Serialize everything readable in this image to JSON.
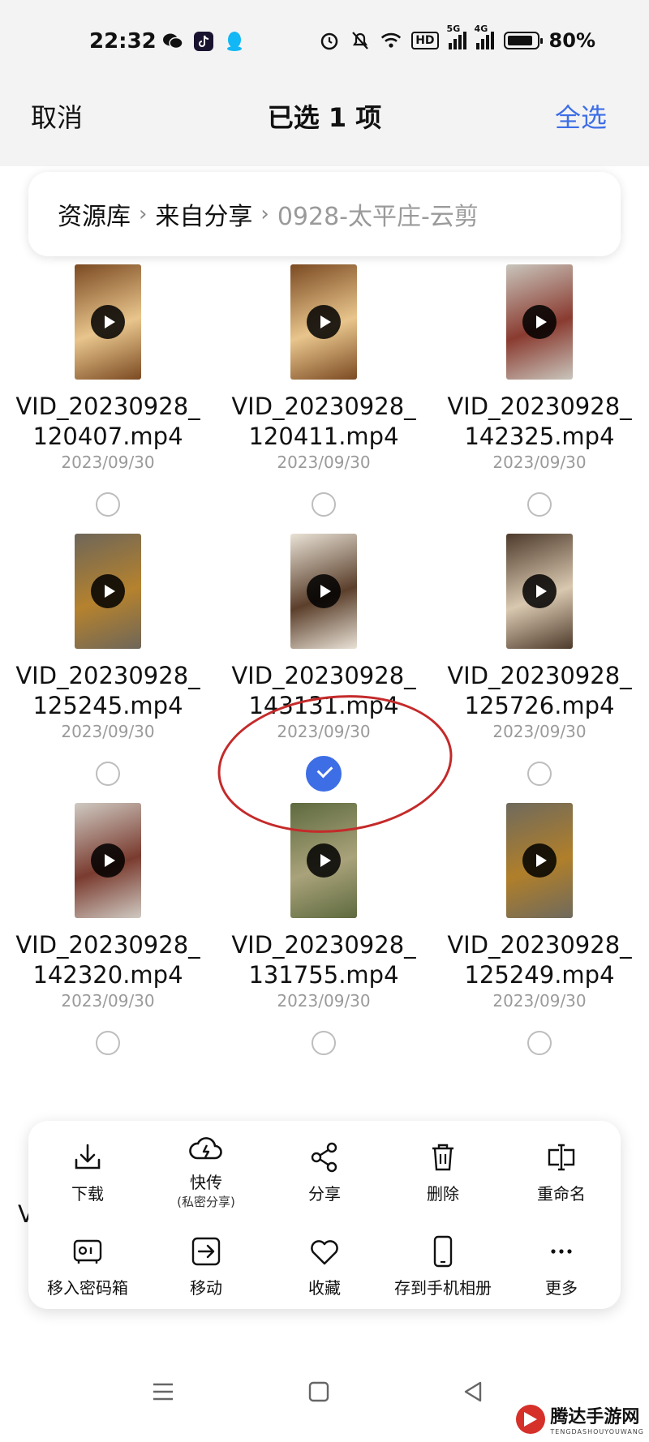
{
  "status_bar": {
    "time": "22:32",
    "left_icons": [
      "wechat-icon",
      "douyin-icon",
      "qq-icon"
    ],
    "right_icons": [
      "alarm-icon",
      "mute-icon",
      "wifi-icon",
      "hd-icon",
      "signal-5g-icon",
      "signal-4g-icon",
      "battery-icon"
    ],
    "hd_label": "HD",
    "sig1_label": "5G",
    "sig2_label": "4G",
    "battery": "80%"
  },
  "header": {
    "cancel": "取消",
    "title": "已选 1 项",
    "select_all": "全选"
  },
  "breadcrumb": [
    "资源库",
    "来自分享",
    "0928-太平庄-云剪"
  ],
  "files": [
    {
      "name1": "VID_20230928_",
      "name2": "120407.mp4",
      "date": "2023/09/30",
      "selected": false,
      "thumb_colors": [
        "#7b4a22",
        "#e8c58c"
      ]
    },
    {
      "name1": "VID_20230928_",
      "name2": "120411.mp4",
      "date": "2023/09/30",
      "selected": false,
      "thumb_colors": [
        "#7b4a22",
        "#e8c58c"
      ]
    },
    {
      "name1": "VID_20230928_",
      "name2": "142325.mp4",
      "date": "2023/09/30",
      "selected": false,
      "thumb_colors": [
        "#c9c5bc",
        "#8a3b30"
      ]
    },
    {
      "name1": "VID_20230928_",
      "name2": "125245.mp4",
      "date": "2023/09/30",
      "selected": false,
      "thumb_colors": [
        "#6e6659",
        "#b5822e"
      ]
    },
    {
      "name1": "VID_20230928_",
      "name2": "143131.mp4",
      "date": "2023/09/30",
      "selected": true,
      "thumb_colors": [
        "#e9e2d6",
        "#5b3f2b"
      ]
    },
    {
      "name1": "VID_20230928_",
      "name2": "125726.mp4",
      "date": "2023/09/30",
      "selected": false,
      "thumb_colors": [
        "#4d3a2b",
        "#d9c8b0"
      ]
    },
    {
      "name1": "VID_20230928_",
      "name2": "142320.mp4",
      "date": "2023/09/30",
      "selected": false,
      "thumb_colors": [
        "#cfcac2",
        "#7a3b2f"
      ]
    },
    {
      "name1": "VID_20230928_",
      "name2": "131755.mp4",
      "date": "2023/09/30",
      "selected": false,
      "thumb_colors": [
        "#5e6a3e",
        "#a9a27a"
      ]
    },
    {
      "name1": "VID_20230928_",
      "name2": "125249.mp4",
      "date": "2023/09/30",
      "selected": false,
      "thumb_colors": [
        "#6f6a5d",
        "#b07f2a"
      ]
    },
    {
      "name1": "V",
      "name2": "",
      "date": "",
      "selected": false,
      "partial": true
    },
    {
      "name1": "",
      "name2": "",
      "date": "",
      "selected": false,
      "partial": true
    },
    {
      "name1": "",
      "name2": "",
      "date": "",
      "selected": false,
      "partial": true
    }
  ],
  "actions": [
    {
      "label": "下载",
      "icon": "download-icon"
    },
    {
      "label": "快传",
      "sub": "(私密分享)",
      "icon": "cloud-flash-icon"
    },
    {
      "label": "分享",
      "icon": "share-icon"
    },
    {
      "label": "删除",
      "icon": "trash-icon"
    },
    {
      "label": "重命名",
      "icon": "rename-icon"
    },
    {
      "label": "移入密码箱",
      "icon": "safe-box-icon"
    },
    {
      "label": "移动",
      "icon": "move-icon"
    },
    {
      "label": "收藏",
      "icon": "heart-icon"
    },
    {
      "label": "存到手机相册",
      "icon": "phone-icon"
    },
    {
      "label": "更多",
      "icon": "more-icon"
    }
  ],
  "nav": [
    "menu-icon",
    "home-square-icon",
    "back-triangle-icon"
  ],
  "watermark": {
    "text": "腾达手游网",
    "sub": "TENGDASHOUYOUWANG"
  },
  "colors": {
    "accent": "#3d6ee6",
    "annotation": "#c42a2a"
  }
}
